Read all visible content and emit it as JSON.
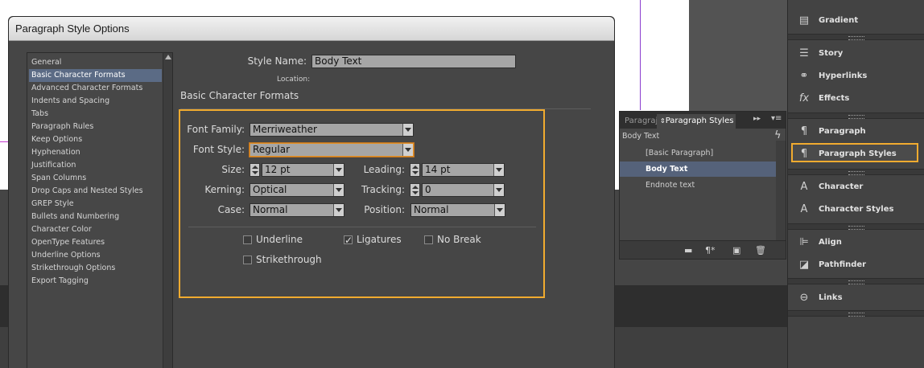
{
  "dialog": {
    "title": "Paragraph Style Options",
    "categories": [
      "General",
      "Basic Character Formats",
      "Advanced Character Formats",
      "Indents and Spacing",
      "Tabs",
      "Paragraph Rules",
      "Keep Options",
      "Hyphenation",
      "Justification",
      "Span Columns",
      "Drop Caps and Nested Styles",
      "GREP Style",
      "Bullets and Numbering",
      "Character Color",
      "OpenType Features",
      "Underline Options",
      "Strikethrough Options",
      "Export Tagging"
    ],
    "selected_category": "Basic Character Formats",
    "style_name_label": "Style Name:",
    "style_name_value": "Body Text",
    "location_label": "Location:",
    "section_heading": "Basic Character Formats",
    "font_family_label": "Font Family:",
    "font_family_value": "Merriweather",
    "font_style_label": "Font Style:",
    "font_style_value": "Regular",
    "size_label": "Size:",
    "size_value": "12 pt",
    "leading_label": "Leading:",
    "leading_value": "14 pt",
    "kerning_label": "Kerning:",
    "kerning_value": "Optical",
    "tracking_label": "Tracking:",
    "tracking_value": "0",
    "case_label": "Case:",
    "case_value": "Normal",
    "position_label": "Position:",
    "position_value": "Normal",
    "underline_label": "Underline",
    "ligatures_label": "Ligatures",
    "nobreak_label": "No Break",
    "strikethrough_label": "Strikethrough",
    "ligatures_checked": true
  },
  "para_panel": {
    "tab_inactive": "Paragraj",
    "tab_active": "Paragraph Styles",
    "current_style": "Body Text",
    "items": [
      "[Basic Paragraph]",
      "Body Text",
      "Endnote text"
    ],
    "selected": "Body Text"
  },
  "dock": {
    "items": [
      "Gradient",
      "Story",
      "Hyperlinks",
      "Effects",
      "Paragraph",
      "Paragraph Styles",
      "Character",
      "Character Styles",
      "Align",
      "Pathfinder",
      "Links"
    ],
    "highlighted": "Paragraph Styles"
  },
  "colors": {
    "highlight": "#f1ab2f",
    "selection": "#5b6b85"
  }
}
